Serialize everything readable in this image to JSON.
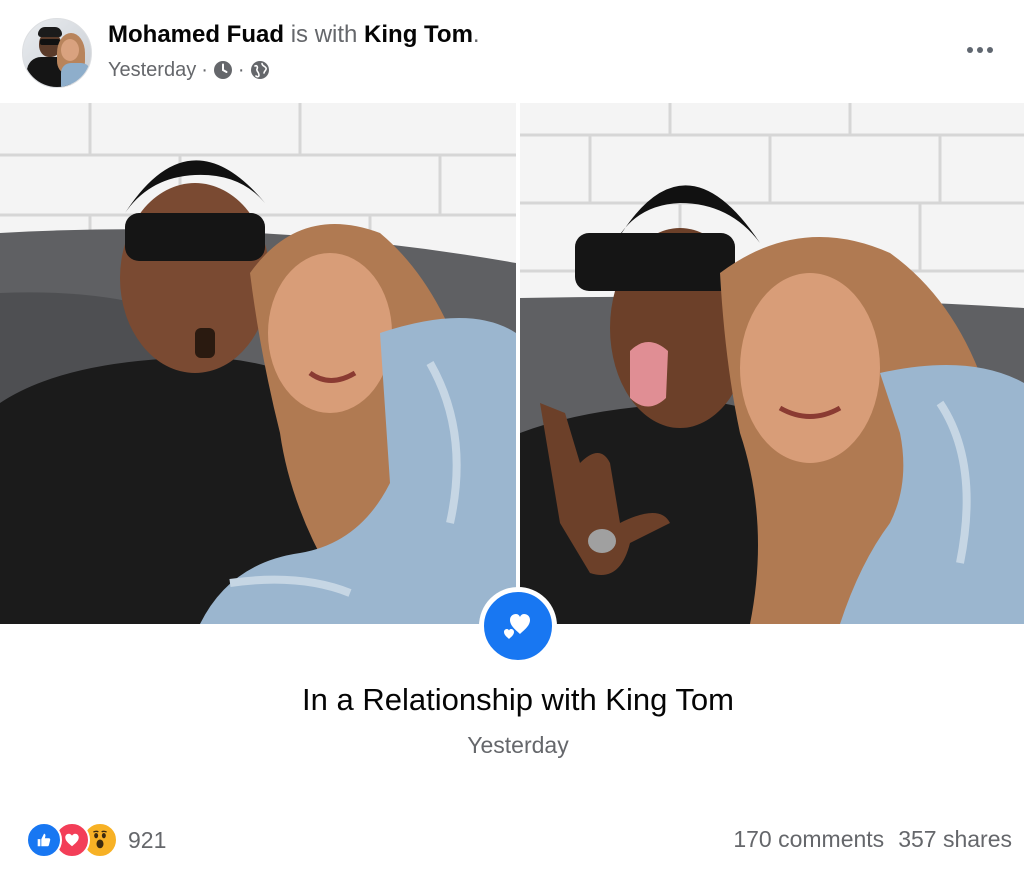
{
  "post": {
    "author": "Mohamed Fuad",
    "connector": "is with",
    "tagged": "King Tom",
    "end_punct": ".",
    "time": "Yesterday",
    "dot": "·",
    "privacy_icon": "globe-icon",
    "time_icon": "clock-icon",
    "more_icon": "more-options-icon"
  },
  "life_event": {
    "icon": "hearts-icon",
    "title": "In a Relationship with King Tom",
    "date": "Yesterday"
  },
  "footer": {
    "reactions": [
      "like",
      "love",
      "wow"
    ],
    "reaction_count": "921",
    "comments": "170 comments",
    "shares": "357 shares"
  },
  "colors": {
    "accent": "#1877f2",
    "muted_text": "#65676b",
    "love": "#f33e58",
    "wow": "#f7b125"
  }
}
